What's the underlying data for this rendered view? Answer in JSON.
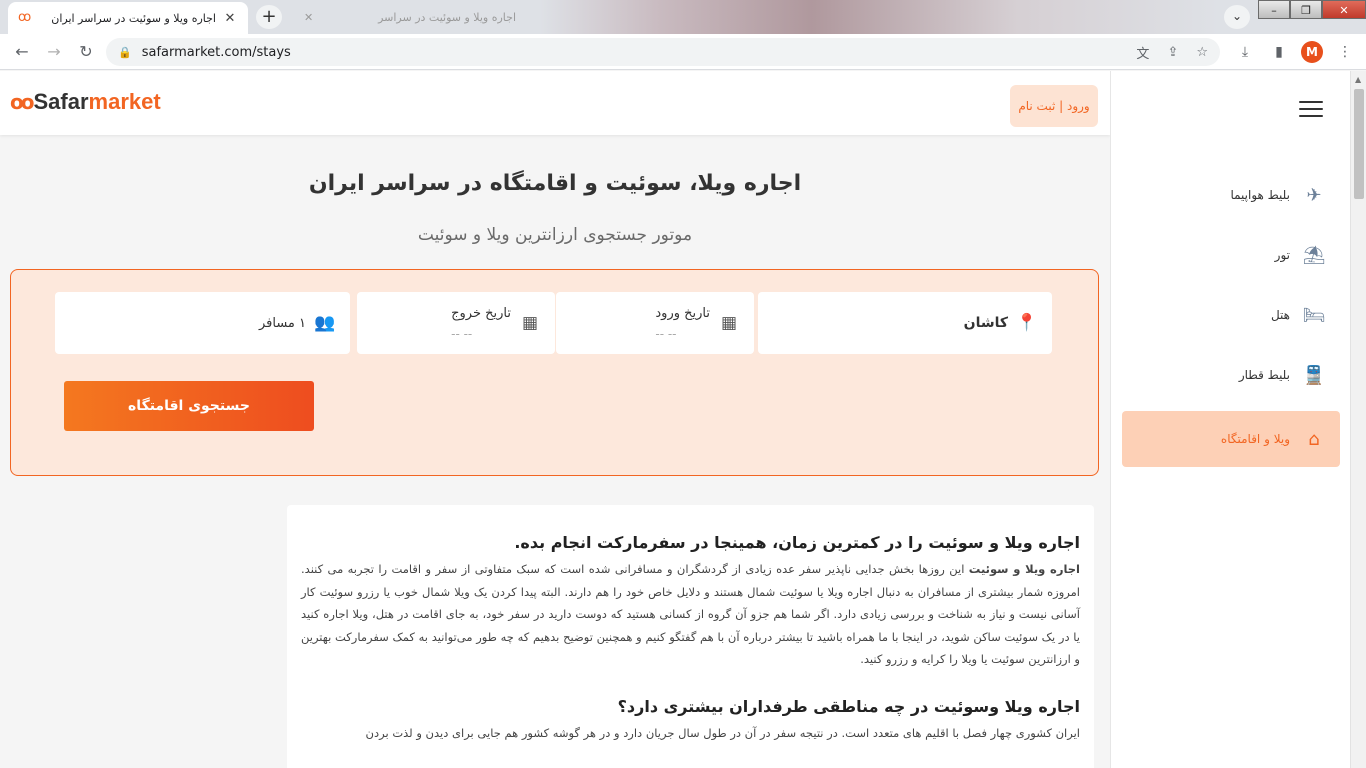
{
  "browser": {
    "active_tab_title": "اجاره ویلا و سوئیت در سراسر ایران",
    "background_tab_title": "اجاره ویلا و سوئیت در سراسر",
    "url": "safarmarket.com/stays",
    "profile_initial": "M"
  },
  "header": {
    "logo_prefix": "Safar",
    "logo_accent": "market",
    "login_label": "ورود | ثبت نام"
  },
  "sidebar": {
    "items": [
      {
        "label": "بلیط هواپیما",
        "icon": "airplane-icon"
      },
      {
        "label": "تور",
        "icon": "beach-umbrella-icon"
      },
      {
        "label": "هتل",
        "icon": "hotel-bed-icon"
      },
      {
        "label": "بلیط قطار",
        "icon": "train-icon"
      },
      {
        "label": "ویلا و اقامتگاه",
        "icon": "home-icon"
      }
    ]
  },
  "hero": {
    "title": "اجاره ویلا، سوئیت و اقامتگاه در سراسر ایران",
    "subtitle": "موتور جستجوی ارزانترین ویلا و سوئیت"
  },
  "search": {
    "destination": "کاشان",
    "checkin_label": "تاریخ ورود",
    "checkin_value": "-- --",
    "checkout_label": "تاریخ خروج",
    "checkout_value": "-- --",
    "passengers": "۱ مسافر",
    "button_label": "جستجوی اقامتگاه"
  },
  "article": {
    "heading1": "اجاره ویلا و سوئیت را در کمترین زمان، همینجا در سفرمارکت انجام بده.",
    "para1_bold": "اجاره ویلا و سوئیت",
    "para1": " این روزها بخش جدایی ناپذیر سفر عده زیادی از گردشگران و مسافرانی شده است که سبک متفاوتی از سفر و اقامت را تجربه می کنند. امروزه شمار بیشتری از مسافران به دنبال اجاره ویلا یا سوئیت شمال هستند و دلایل خاص خود را هم دارند. البته پیدا کردن یک ویلا شمال خوب یا رزرو سوئیت کار آسانی نیست و نیاز به شناخت و بررسی زیادی دارد. اگر شما هم جزو آن گروه از کسانی هستید که دوست دارید در سفر خود، به جای اقامت در هتل، ویلا اجاره کنید یا در یک سوئیت ساکن شوید، در اینجا با ما همراه باشید تا بیشتر درباره آن با هم گفتگو کنیم و همچنین توضیح بدهیم که چه طور می‌توانید به کمک سفرمارکت بهترین و ارزانترین سوئیت یا ویلا را کرایه و رزرو کنید.",
    "heading2": "اجاره ویلا وسوئیت در چه مناطقی طرفداران بیشتری دارد؟",
    "para2": "ایران کشوری چهار فصل با اقلیم های متعدد است. در نتیجه سفر در آن در طول سال جریان دارد و در هر گوشه کشور هم جایی برای دیدن و لذت بردن"
  }
}
